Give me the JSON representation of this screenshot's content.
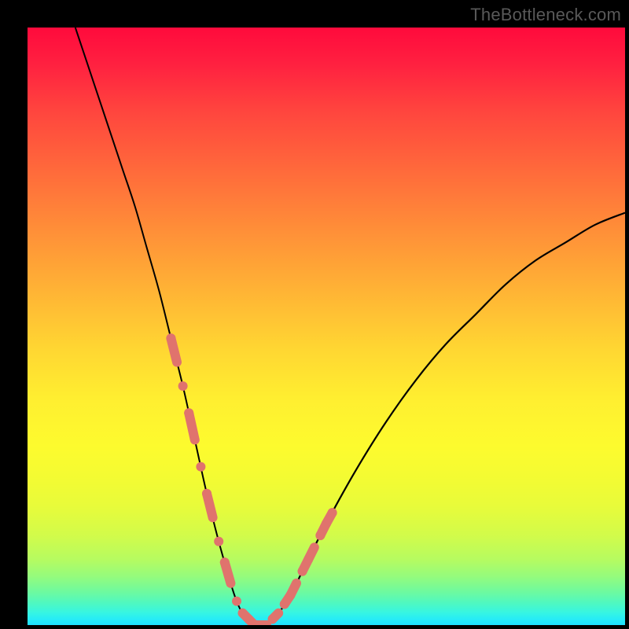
{
  "watermark": "TheBottleneck.com",
  "chart_data": {
    "type": "line",
    "title": "",
    "xlabel": "",
    "ylabel": "",
    "xlim": [
      0,
      100
    ],
    "ylim": [
      0,
      100
    ],
    "series": [
      {
        "name": "curve",
        "x": [
          8,
          10,
          12,
          14,
          16,
          18,
          20,
          22,
          24,
          26,
          28,
          30,
          32,
          34,
          35,
          36,
          38,
          40,
          42,
          44,
          46,
          50,
          55,
          60,
          65,
          70,
          75,
          80,
          85,
          90,
          95,
          100
        ],
        "values": [
          100,
          94,
          88,
          82,
          76,
          70,
          63,
          56,
          48,
          40,
          31,
          22,
          14,
          7,
          4,
          2,
          0,
          0,
          2,
          5,
          9,
          17,
          26,
          34,
          41,
          47,
          52,
          57,
          61,
          64,
          67,
          69
        ]
      }
    ],
    "highlight_points": {
      "comment": "salmon marker dots/segments near valley",
      "left_branch_x": [
        24,
        25,
        26,
        27,
        28,
        29,
        30,
        31,
        32,
        33,
        34,
        35
      ],
      "right_branch_x": [
        41,
        42,
        43,
        44,
        45,
        46,
        47,
        48,
        49,
        50,
        51
      ],
      "bottom_x": [
        36,
        37,
        38,
        39,
        40
      ]
    },
    "gradient_stops": [
      {
        "pos": 0.0,
        "color": "#ff0a3c"
      },
      {
        "pos": 0.5,
        "color": "#ffd732"
      },
      {
        "pos": 0.75,
        "color": "#f4fb32"
      },
      {
        "pos": 1.0,
        "color": "#1ee0ff"
      }
    ]
  }
}
